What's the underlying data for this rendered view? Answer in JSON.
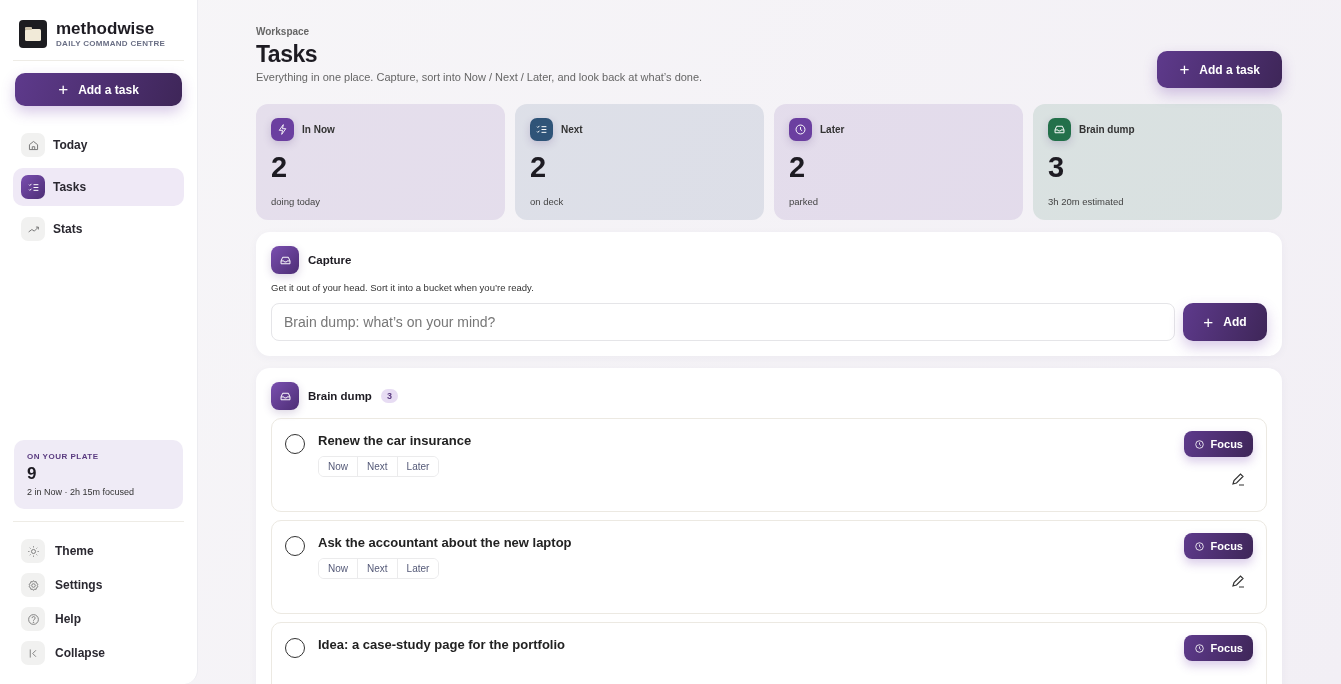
{
  "brand": {
    "name": "methodwise",
    "tagline": "DAILY COMMAND CENTRE"
  },
  "sidebar": {
    "add_button": {
      "icon": "+",
      "label": "Add a task"
    },
    "nav": [
      {
        "label": "Today",
        "selected": false
      },
      {
        "label": "Tasks",
        "selected": true
      },
      {
        "label": "Stats",
        "selected": false
      }
    ],
    "plate": {
      "title": "ON YOUR PLATE",
      "count": "9",
      "detail": "2 in Now · 2h 15m focused"
    },
    "footer": [
      {
        "label": "Theme"
      },
      {
        "label": "Settings"
      },
      {
        "label": "Help"
      },
      {
        "label": "Collapse"
      }
    ]
  },
  "header": {
    "eyebrow": "Workspace",
    "title": "Tasks",
    "subtitle": "Everything in one place. Capture, sort into Now / Next / Later, and look back at what’s done.",
    "add_button": {
      "icon": "+",
      "label": "Add a task"
    }
  },
  "stats": [
    {
      "label": "In Now",
      "color": "#6b3fa0",
      "value": "2",
      "caption": "doing today"
    },
    {
      "label": "Next",
      "color": "#2f5478",
      "value": "2",
      "caption": "on deck"
    },
    {
      "label": "Later",
      "color": "#6b3fa0",
      "value": "2",
      "caption": "parked"
    },
    {
      "label": "Brain dump",
      "color": "#23704a",
      "value": "3",
      "caption": "3h 20m estimated"
    }
  ],
  "capture": {
    "title": "Capture",
    "hint": "Get it out of your head. Sort it into a bucket when you’re ready.",
    "placeholder": "Brain dump: what’s on your mind?",
    "button": {
      "icon": "+",
      "label": "Add"
    }
  },
  "brain_dump": {
    "title": "Brain dump",
    "count": "3",
    "tasks": [
      {
        "title": "Renew the car insurance",
        "checked": false,
        "buckets": [
          "Now",
          "Next",
          "Later"
        ],
        "focus": "Focus"
      },
      {
        "title": "Ask the accountant about the new laptop",
        "checked": false,
        "buckets": [
          "Now",
          "Next",
          "Later"
        ],
        "focus": "Focus"
      },
      {
        "title": "Idea: a case-study page for the portfolio",
        "checked": false,
        "focus": "Focus"
      }
    ]
  }
}
